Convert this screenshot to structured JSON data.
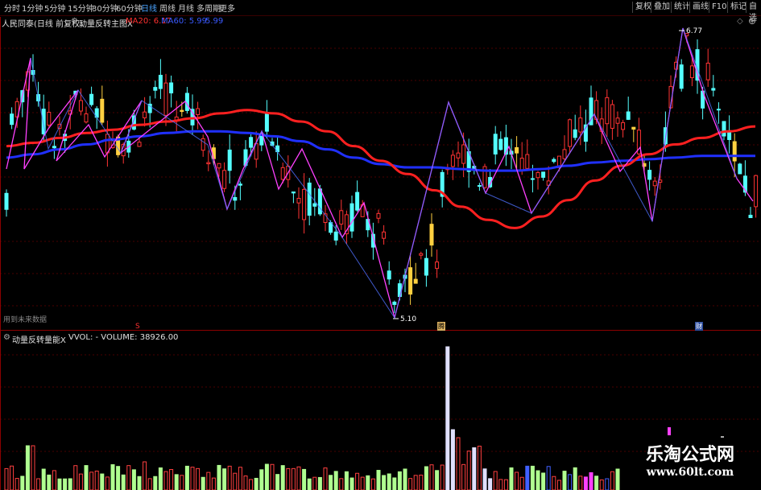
{
  "toolbar": {
    "periods": [
      "分时",
      "1分钟",
      "5分钟",
      "15分钟",
      "30分钟",
      "60分钟",
      "日线",
      "周线",
      "月线",
      "多周期",
      "更多"
    ],
    "active_period": "日线",
    "right_buttons": [
      "复权",
      "叠加",
      "统计",
      "画线",
      "F10",
      "标记",
      "自选"
    ]
  },
  "main": {
    "stock": "人民同泰(日线 前复权)",
    "indicator": "动量反转主图X",
    "ma20_label": "MA20: 6.17",
    "ma60_label": "MA60: 5.99",
    "extra_label": "5.99",
    "high_label": "6.77",
    "low_label": "5.10",
    "future_label": "用到未来数据",
    "marker_s": "S",
    "marker_cai": "财",
    "marker_teng": "腾"
  },
  "vol": {
    "indicator": "动量反转量能X",
    "vol_label": "VVOL: - VOLUME: 38926.00"
  },
  "colors": {
    "up": "#ff3333",
    "down": "#54ffff",
    "ma20": "#ff2020",
    "ma60": "#2030ff",
    "zigzag": "#ff40ff",
    "accent": "#4aa3ff"
  },
  "watermark": {
    "line1": "乐淘公式网",
    "line2": "www.60lt.com"
  },
  "chart_data": [
    {
      "type": "candlestick",
      "title": "人民同泰(日线 前复权)",
      "series": [
        {
          "name": "MA20",
          "values": [
            6.05,
            6.07,
            6.1,
            6.13,
            6.15,
            6.18,
            6.2,
            6.22,
            6.25,
            6.27,
            6.25,
            6.2,
            6.14,
            6.05,
            5.96,
            5.88,
            5.78,
            5.68,
            5.6,
            5.55,
            5.62,
            5.72,
            5.84,
            5.93,
            6.0,
            6.06,
            6.1,
            6.14,
            6.17
          ]
        },
        {
          "name": "MA60",
          "values": [
            5.98,
            6.0,
            6.03,
            6.06,
            6.09,
            6.11,
            6.13,
            6.14,
            6.14,
            6.13,
            6.11,
            6.08,
            6.03,
            5.98,
            5.94,
            5.92,
            5.92,
            5.91,
            5.9,
            5.9,
            5.91,
            5.93,
            5.95,
            5.96,
            5.97,
            5.98,
            5.99,
            5.99,
            5.99
          ]
        }
      ],
      "annotations": [
        "6.77",
        "5.10"
      ]
    },
    {
      "type": "bar",
      "title": "VVOL: - VOLUME: 38926.00"
    }
  ]
}
